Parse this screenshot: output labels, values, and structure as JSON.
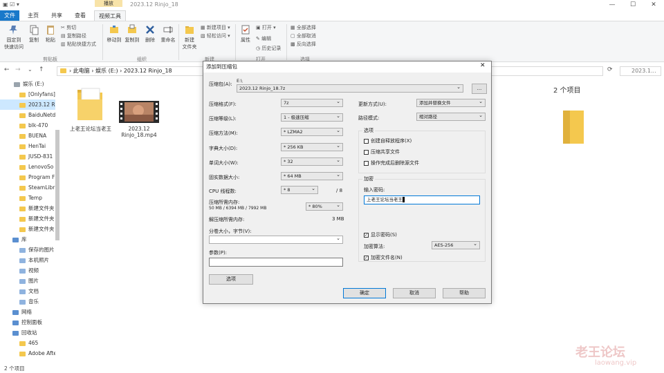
{
  "titlebar": {
    "context_tab": "播放",
    "title": "2023.12 Rinjo_18"
  },
  "tabs": [
    "文件",
    "主页",
    "共享",
    "查看",
    "视频工具"
  ],
  "ribbon": {
    "pin": "固定到\n快速访问",
    "copy": "复制",
    "paste": "粘贴",
    "cut": "剪切",
    "copy_path": "复制路径",
    "paste_shortcut": "粘贴快捷方式",
    "move_to": "移动到",
    "copy_to": "复制到",
    "delete": "删除",
    "rename": "重命名",
    "new_folder": "新建\n文件夹",
    "new_item": "新建项目 ▾",
    "easy_access": "轻松访问 ▾",
    "properties": "属性",
    "open": "打开 ▾",
    "edit": "编辑",
    "history": "历史记录",
    "select_all": "全部选择",
    "select_none": "全部取消",
    "invert": "反向选择",
    "groups": [
      "剪贴板",
      "组织",
      "新建",
      "打开",
      "选择"
    ]
  },
  "address": {
    "path": "›  此电脑  ›  娱乐 (E:)  ›  2023.12 Rinjo_18",
    "search": "2023.1..."
  },
  "sidebar": {
    "items": [
      {
        "label": "娱乐 (E:)",
        "selected": false
      },
      {
        "label": "[Onlyfans]",
        "selected": false
      },
      {
        "label": "2023.12 R",
        "selected": true
      },
      {
        "label": "BaiduNetd",
        "selected": false
      },
      {
        "label": "blk-470",
        "selected": false
      },
      {
        "label": "BUENA",
        "selected": false
      },
      {
        "label": "HenTai",
        "selected": false
      },
      {
        "label": "JUSD-831",
        "selected": false
      },
      {
        "label": "LenovoSo",
        "selected": false
      },
      {
        "label": "Program F",
        "selected": false
      },
      {
        "label": "SteamLibr",
        "selected": false
      },
      {
        "label": "Temp",
        "selected": false
      },
      {
        "label": "新建文件夹",
        "selected": false
      },
      {
        "label": "新建文件夹",
        "selected": false
      },
      {
        "label": "新建文件夹",
        "selected": false
      },
      {
        "label": "库",
        "selected": false
      },
      {
        "label": "保存的图片",
        "selected": false
      },
      {
        "label": "本机照片",
        "selected": false
      },
      {
        "label": "视频",
        "selected": false
      },
      {
        "label": "图片",
        "selected": false
      },
      {
        "label": "文档",
        "selected": false
      },
      {
        "label": "音乐",
        "selected": false
      },
      {
        "label": "网络",
        "selected": false
      },
      {
        "label": "控制面板",
        "selected": false
      },
      {
        "label": "回收站",
        "selected": false
      },
      {
        "label": "465",
        "selected": false
      },
      {
        "label": "Adobe After",
        "selected": false
      }
    ]
  },
  "files": [
    {
      "name": "上老王论坛当老王"
    },
    {
      "name": "2023.12 Rinjo_18.mp4"
    }
  ],
  "preview": {
    "count": "2 个项目"
  },
  "status": "2 个项目",
  "dialog": {
    "title": "添加到压缩包",
    "archive_label": "压缩包(A):",
    "archive_dir": "E:\\",
    "archive_name": "2023.12 Rinjo_18.7z",
    "browse": "...",
    "format_label": "压缩格式(F):",
    "format": "7z",
    "level_label": "压缩等级(L):",
    "level": "1 - 极速压缩",
    "method_label": "压缩方法(M):",
    "method": "* LZMA2",
    "dict_label": "字典大小(D):",
    "dict": "* 256 KB",
    "word_label": "单词大小(W):",
    "word": "* 32",
    "solid_label": "固实数据大小:",
    "solid": "* 64 MB",
    "cpu_label": "CPU 线程数:",
    "cpu": "* 8",
    "cpu_max": "/ 8",
    "mem_label": "压缩所需内存:",
    "mem_detail": "50 MB / 6394 MB / 7992 MB",
    "mem_percent": "* 80%",
    "decomp_label": "解压缩所需内存:",
    "decomp": "3 MB",
    "split_label": "分卷大小，字节(V):",
    "params_label": "参数(P):",
    "options_btn": "选项",
    "update_label": "更新方式(U):",
    "update": "添加并替换文件",
    "path_label": "路径模式:",
    "path_mode": "相对路径",
    "options_title": "选项",
    "opt1": "创建自释放程序(X)",
    "opt2": "压缩共享文件",
    "opt3": "操作完成后删除源文件",
    "enc_title": "加密",
    "pwd_label": "输入密码:",
    "pwd_value": "上老王论坛当老王",
    "show_pwd": "显示密码(S)",
    "enc_method_label": "加密算法:",
    "enc_method": "AES-256",
    "enc_names": "加密文件名(N)",
    "ok": "确定",
    "cancel": "取消",
    "help": "帮助"
  },
  "watermark": {
    "cn": "老王论坛",
    "en": "laowang.vip"
  }
}
